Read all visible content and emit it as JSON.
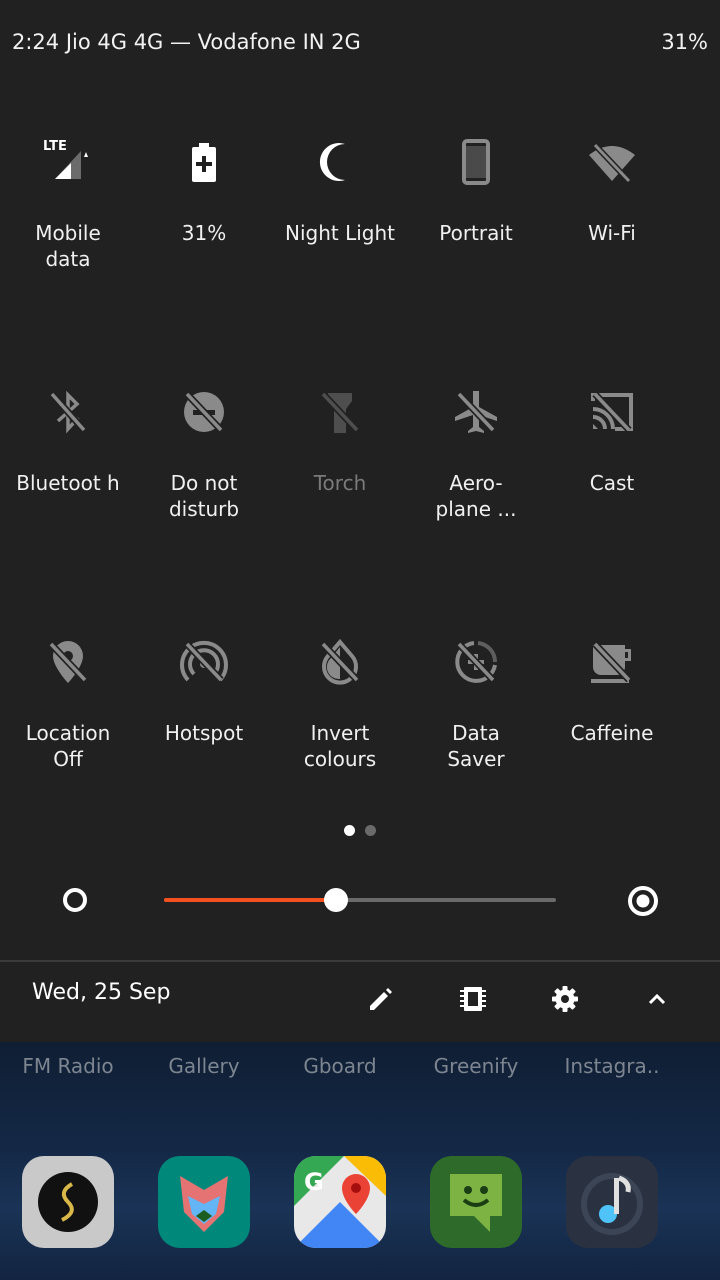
{
  "status_bar": {
    "time_carrier": "2:24   Jio 4G 4G — Vodafone IN 2G",
    "battery": "31%"
  },
  "quick_settings": {
    "tiles": [
      {
        "label": "Mobile data",
        "icon": "signal-lte-icon",
        "state": "active"
      },
      {
        "label": "31%",
        "icon": "battery-charging-icon",
        "state": "active"
      },
      {
        "label": "Night Light",
        "icon": "moon-icon",
        "state": "active"
      },
      {
        "label": "Portrait",
        "icon": "phone-portrait-icon",
        "state": "inactive"
      },
      {
        "label": "Wi-Fi",
        "icon": "wifi-off-icon",
        "state": "inactive"
      },
      {
        "label": "Bluetoot h",
        "icon": "bluetooth-off-icon",
        "state": "inactive"
      },
      {
        "label": "Do not disturb",
        "icon": "do-not-disturb-off-icon",
        "state": "inactive"
      },
      {
        "label": "Torch",
        "icon": "torch-off-icon",
        "state": "unavailable"
      },
      {
        "label": "Aero- plane ...",
        "icon": "airplane-off-icon",
        "state": "inactive"
      },
      {
        "label": "Cast",
        "icon": "cast-off-icon",
        "state": "inactive"
      },
      {
        "label": "Location Off",
        "icon": "location-off-icon",
        "state": "inactive"
      },
      {
        "label": "Hotspot",
        "icon": "hotspot-off-icon",
        "state": "inactive"
      },
      {
        "label": "Invert colours",
        "icon": "invert-colors-off-icon",
        "state": "inactive"
      },
      {
        "label": "Data Saver",
        "icon": "data-saver-off-icon",
        "state": "inactive"
      },
      {
        "label": "Caffeine",
        "icon": "coffee-off-icon",
        "state": "inactive"
      }
    ],
    "page_count": 2,
    "active_page": 1
  },
  "brightness": {
    "level": 0.44,
    "accent_color": "#f4511e"
  },
  "footer": {
    "date": "Wed, 25 Sep",
    "buttons": [
      "edit-icon",
      "memory-icon",
      "settings-icon",
      "collapse-icon"
    ]
  },
  "home_screen": {
    "app_labels": [
      "FM Radio",
      "Gallery",
      "Gboard",
      "Greenify",
      "Instagra.."
    ],
    "dock_apps": [
      "sketch-app-icon",
      "magisk-app-icon",
      "maps-app-icon",
      "hangouts-app-icon",
      "music-app-icon"
    ]
  }
}
